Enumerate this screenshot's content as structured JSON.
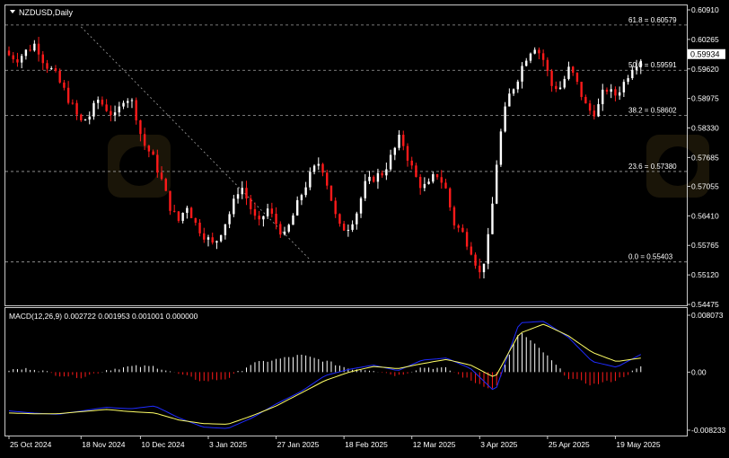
{
  "colors": {
    "background": "#000000",
    "frame": "#c8c8c8",
    "grid": "#a0a0a0",
    "text": "#ffffff",
    "bull": "#ffffff",
    "bear": "#ff1a1a",
    "price_box_bg": "#ffffff",
    "price_box_text": "#000000",
    "macd_line": "#1f2bff",
    "signal_line": "#ffff66",
    "trendline": "#a0a0a0"
  },
  "main_chart": {
    "symbol_label": "NZDUSD,Daily",
    "symbol_icon": "triangle-down-icon",
    "current_price": "0.59934",
    "current_price_value": 0.59934,
    "y_range": [
      0.54475,
      0.6091
    ],
    "y_ticks": [
      "0.60910",
      "0.60265",
      "0.59620",
      "0.58975",
      "0.58330",
      "0.57685",
      "0.57055",
      "0.56410",
      "0.55765",
      "0.55120",
      "0.54475"
    ],
    "y_tick_values": [
      0.6091,
      0.60265,
      0.5962,
      0.58975,
      0.5833,
      0.57685,
      0.57055,
      0.5641,
      0.55765,
      0.5512,
      0.54475
    ],
    "fib_levels": [
      {
        "label": "61.8 = 0.60579",
        "value": 0.60579
      },
      {
        "label": "50.0 = 0.59591",
        "value": 0.59591
      },
      {
        "label": "38.2 = 0.58602",
        "value": 0.58602
      },
      {
        "label": "23.6 = 0.57380",
        "value": 0.5738
      },
      {
        "label": "0.0 = 0.55403",
        "value": 0.55403
      }
    ],
    "trendline": {
      "from": {
        "bar": 17,
        "value": 0.6054
      },
      "to": {
        "bar": 71,
        "value": 0.5545
      }
    }
  },
  "x_axis": {
    "labels": [
      "25 Oct 2024",
      "18 Nov 2024",
      "10 Dec 2024",
      "3 Jan 2025",
      "27 Jan 2025",
      "18 Feb 2025",
      "12 Mar 2025",
      "3 Apr 2025",
      "25 Apr 2025",
      "19 May 2025"
    ],
    "label_bars": [
      0,
      17,
      31,
      47,
      63,
      79,
      95,
      111,
      127,
      143
    ]
  },
  "macd": {
    "label": "MACD(12,26,9) 0.002722 0.001953 0.001001 0.000000",
    "y_range": [
      -0.008233,
      0.008073
    ],
    "y_ticks": [
      "0.008073",
      "0.00",
      "-0.008233"
    ],
    "y_tick_values": [
      0.008073,
      0.0,
      -0.008233
    ],
    "macd_anchor_values": [
      -0.0055,
      -0.0058,
      -0.006,
      -0.0055,
      -0.005,
      -0.0052,
      -0.0048,
      -0.0065,
      -0.0078,
      -0.008,
      -0.0065,
      -0.0045,
      -0.0028,
      -0.0005,
      0.0004,
      0.001,
      0.0002,
      0.0017,
      0.002,
      0.0005,
      -0.0028,
      0.007,
      0.0072,
      0.005,
      0.0015,
      0.0007,
      0.0025
    ],
    "signal_anchor_values": [
      -0.0058,
      -0.0059,
      -0.0059,
      -0.0056,
      -0.0053,
      -0.0056,
      -0.0058,
      -0.0068,
      -0.0073,
      -0.0074,
      -0.0062,
      -0.0048,
      -0.003,
      -0.0012,
      0.0,
      0.0008,
      0.0005,
      0.0012,
      0.0018,
      0.001,
      -0.0008,
      0.0055,
      0.0068,
      0.0052,
      0.0028,
      0.0015,
      0.002
    ],
    "histogram_anchor_values": [
      0.0003,
      0.0005,
      -0.0004,
      -0.0007,
      0.0003,
      0.0008,
      0.0008,
      -0.0003,
      -0.0013,
      -0.0009,
      0.0012,
      0.0018,
      0.0024,
      0.0016,
      0.0005,
      0.0003,
      -0.0005,
      0.0007,
      0.0005,
      -0.0012,
      -0.0025,
      0.0058,
      0.0028,
      -0.0008,
      -0.0018,
      -0.0011,
      0.0007
    ]
  },
  "chart_data": [
    {
      "type": "candlestick",
      "title": "NZDUSD,Daily",
      "x_categories": [
        "25 Oct 2024",
        "18 Nov 2024",
        "10 Dec 2024",
        "3 Jan 2025",
        "27 Jan 2025",
        "18 Feb 2025",
        "12 Mar 2025",
        "3 Apr 2025",
        "25 Apr 2025",
        "19 May 2025"
      ],
      "ylim": [
        0.54475,
        0.6091
      ],
      "bar_count": 150,
      "close_anchor_values": [
        0.5992,
        0.5985,
        0.6002,
        0.6018,
        0.5975,
        0.5955,
        0.5922,
        0.5885,
        0.5845,
        0.5858,
        0.5895,
        0.5875,
        0.5855,
        0.5905,
        0.5885,
        0.5802,
        0.5775,
        0.5728,
        0.5665,
        0.5628,
        0.5665,
        0.5622,
        0.5598,
        0.5575,
        0.5615,
        0.5655,
        0.5712,
        0.5665,
        0.5618,
        0.5658,
        0.5625,
        0.5595,
        0.5645,
        0.5695,
        0.5735,
        0.5762,
        0.5695,
        0.5615,
        0.5615,
        0.5645,
        0.5708,
        0.5725,
        0.5735,
        0.5772,
        0.5815,
        0.5758,
        0.5712,
        0.5702,
        0.5735,
        0.5705,
        0.5625,
        0.5602,
        0.5565,
        0.5508,
        0.5605,
        0.5795,
        0.5895,
        0.5935,
        0.5985,
        0.6015,
        0.5985,
        0.5925,
        0.5922,
        0.5965,
        0.5922,
        0.5872,
        0.5868,
        0.5922,
        0.5902,
        0.5928,
        0.5968,
        0.5985
      ],
      "values_note": "",
      "series": [
        {
          "name": "NZDUSD"
        }
      ]
    },
    {
      "type": "line",
      "title": "MACD(12,26,9) 0.002722 0.001953 0.001001 0.000000",
      "ylim": [
        -0.008233,
        0.008073
      ]
    }
  ],
  "watermark": {
    "icon": "wikifx-logo-icon"
  }
}
